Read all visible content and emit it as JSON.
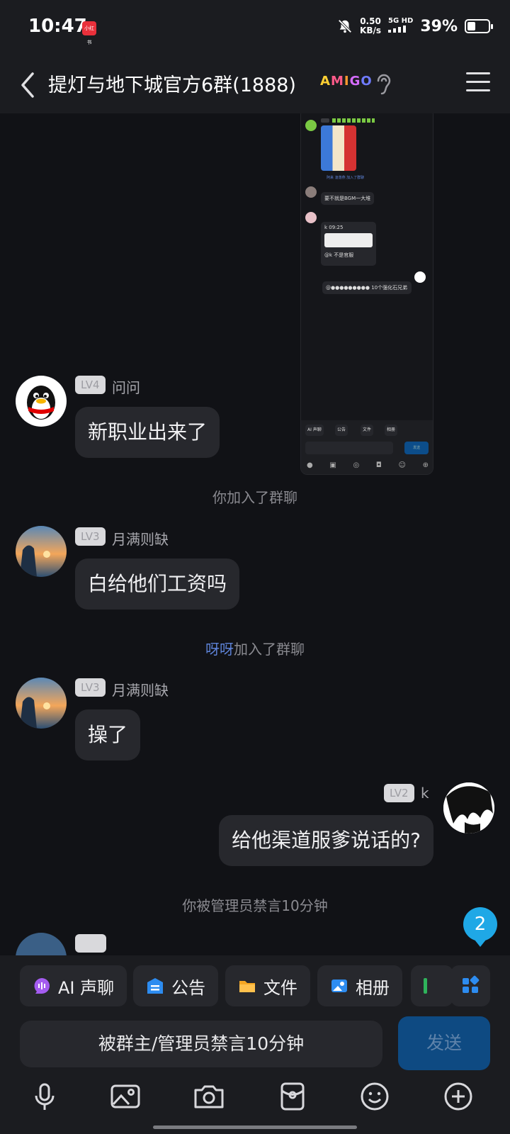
{
  "status_bar": {
    "time": "10:47",
    "app_badge": "小红书",
    "net_speed_value": "0.50",
    "net_speed_unit": "KB/s",
    "network": "5G HD",
    "battery": "39%",
    "battery_level": 0.39
  },
  "header": {
    "title": "提灯与地下城官方6群(1888)",
    "badge_letters": [
      "A",
      "M",
      "I",
      "G",
      "O"
    ]
  },
  "screenshot_message": {
    "sys_line": "阿来 凌落燕 加入了群聊",
    "bubble1": "要不就是BGM一大堆",
    "forward_time": "k 09:25",
    "bubble2": "@k 不是官服",
    "bubble3": "@●●●●●●●●● 10个强化石兄弟",
    "toolbar": [
      "AI 声聊",
      "公告",
      "文件",
      "相册"
    ],
    "send": "发送"
  },
  "messages": [
    {
      "level": "LV4",
      "nick": "问问",
      "text": "新职业出来了"
    },
    {
      "level": "LV3",
      "nick": "月满则缺",
      "text": "白给他们工资吗"
    },
    {
      "level": "LV3",
      "nick": "月满则缺",
      "text": "操了"
    },
    {
      "level": "LV2",
      "nick": "k",
      "text": "给他渠道服爹说话的?"
    }
  ],
  "system": {
    "you_joined": "你加入了群聊",
    "yaya_name": "呀呀",
    "joined_suffix": "加入了群聊",
    "muted_notice": "你被管理员禁言10分钟"
  },
  "unread_count": "2",
  "toolbar": {
    "chips": [
      {
        "label": "AI 声聊",
        "icon": "ai-voice-icon"
      },
      {
        "label": "公告",
        "icon": "announcement-icon"
      },
      {
        "label": "文件",
        "icon": "folder-icon"
      },
      {
        "label": "相册",
        "icon": "album-icon"
      }
    ],
    "muted_placeholder": "被群主/管理员禁言10分钟",
    "send_label": "发送",
    "tools": [
      "microphone-icon",
      "image-icon",
      "camera-icon",
      "red-packet-icon",
      "emoji-icon",
      "plus-icon"
    ]
  },
  "colors": {
    "background": "#111216",
    "bubble": "#27282d",
    "link": "#5d82d6",
    "unread": "#1fa8e6",
    "send_disabled": "#0e4a82"
  }
}
